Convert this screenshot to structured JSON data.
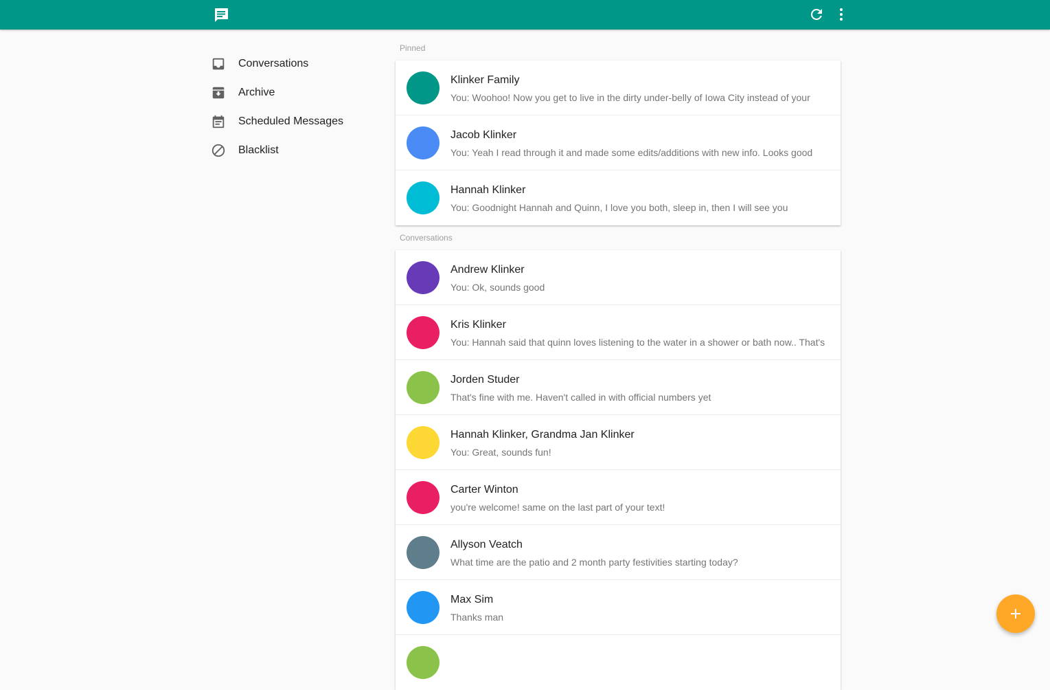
{
  "toolbar": {
    "logo_icon": "message-icon",
    "refresh_icon": "refresh-icon",
    "more_icon": "more-vert-icon",
    "color": "#009688"
  },
  "nav": {
    "items": [
      {
        "label": "Conversations",
        "icon": "inbox-icon"
      },
      {
        "label": "Archive",
        "icon": "archive-icon"
      },
      {
        "label": "Scheduled Messages",
        "icon": "calendar-icon"
      },
      {
        "label": "Blacklist",
        "icon": "block-icon"
      }
    ]
  },
  "pinned": {
    "header": "Pinned",
    "conversations": [
      {
        "name": "Klinker Family",
        "snippet": "You: Woohoo! Now you get to live in the dirty under-belly of Iowa City instead of your",
        "color": "#009688"
      },
      {
        "name": "Jacob Klinker",
        "snippet": "You: Yeah I read through it and made some edits/additions with new info. Looks good",
        "color": "#4b8bf5"
      },
      {
        "name": "Hannah Klinker",
        "snippet": "You: Goodnight Hannah and Quinn, I love you both, sleep in, then I will see you",
        "color": "#00bcd4"
      }
    ]
  },
  "conversations": {
    "header": "Conversations",
    "items": [
      {
        "name": "Andrew Klinker",
        "snippet": "You: Ok, sounds good",
        "color": "#673ab7"
      },
      {
        "name": "Kris Klinker",
        "snippet": "You: Hannah said that quinn loves listening to the water in a shower or bath now.. That's",
        "color": "#e91e63"
      },
      {
        "name": "Jorden Studer",
        "snippet": "That's fine with me. Haven't called in with official numbers yet",
        "color": "#8bc34a"
      },
      {
        "name": "Hannah Klinker, Grandma Jan Klinker",
        "snippet": "You: Great, sounds fun!",
        "color": "#fdd835"
      },
      {
        "name": "Carter Winton",
        "snippet": "you're welcome! same on the last part of your text!",
        "color": "#e91e63"
      },
      {
        "name": "Allyson Veatch",
        "snippet": "What time are the patio and 2 month party festivities starting today?",
        "color": "#607d8b"
      },
      {
        "name": "Max Sim",
        "snippet": "Thanks man",
        "color": "#2196f3"
      },
      {
        "name": "",
        "snippet": "",
        "color": "#8bc34a"
      }
    ]
  },
  "fab": {
    "icon": "add-icon",
    "color": "#ffa726"
  }
}
